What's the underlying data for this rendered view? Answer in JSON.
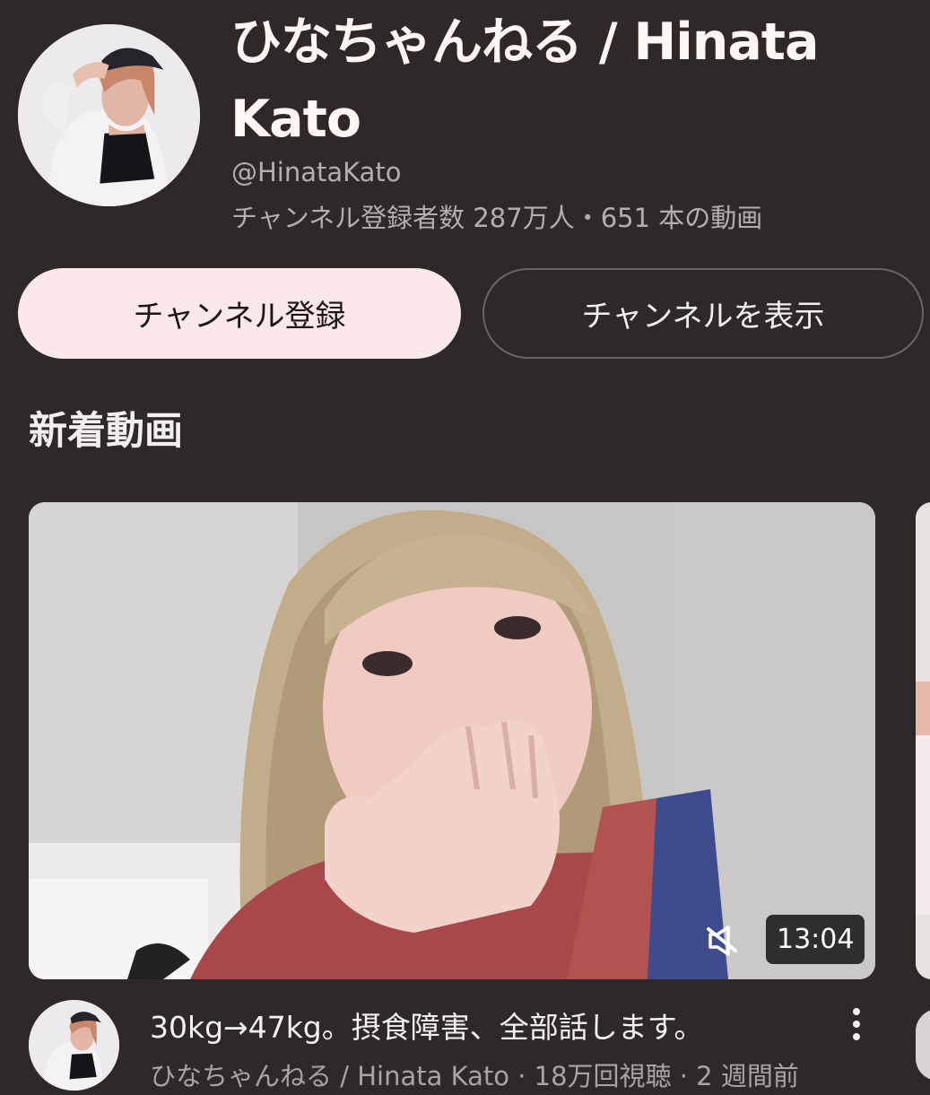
{
  "channel": {
    "name": "ひなちゃんねる / Hinata Kato",
    "handle": "@HinataKato",
    "stats": "チャンネル登録者数 287万人・651 本の動画"
  },
  "buttons": {
    "subscribe_label": "チャンネル登録",
    "view_channel_label": "チャンネルを表示"
  },
  "section": {
    "title": "新着動画"
  },
  "video": {
    "duration": "13:04",
    "title": "30kg→47kg。摂食障害、全部話します。",
    "meta": "ひなちゃんねる / Hinata Kato · 18万回視聴 · 2 週間前"
  },
  "icons": {
    "mute": "volume-off-icon",
    "more": "more-vert-icon"
  },
  "colors": {
    "background": "#2f2829",
    "subscribe_button": "#fbe8e8",
    "secondary_text": "#b5aeae"
  }
}
